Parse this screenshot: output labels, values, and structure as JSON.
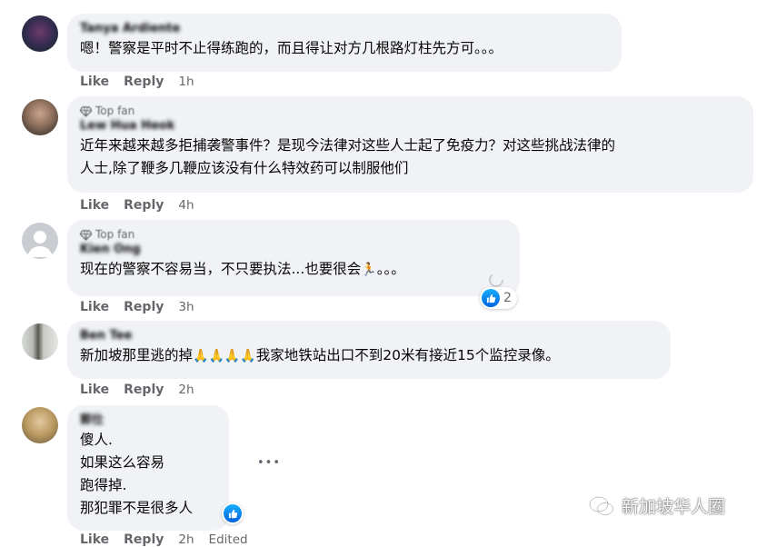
{
  "comments": [
    {
      "name": "Tanya Ardiente",
      "badge": "",
      "text": "嗯！警察是平时不止得练跑的，而且得让对方几根路灯柱先方可。。。",
      "like": "Like",
      "reply": "Reply",
      "time": "1h"
    },
    {
      "name": "Lew Hua Heok",
      "badge": "Top fan",
      "text": "近年来越来越多拒捕袭警事件？是现今法律对这些人士起了免疫力？对这些挑战法律的\n人士,除了鞭多几鞭应该没有什么特效药可以制服他们",
      "like": "Like",
      "reply": "Reply",
      "time": "4h"
    },
    {
      "name": "Kien Ong",
      "badge": "Top fan",
      "text_before": "现在的警察不容易当，不只要执法...也要很会",
      "emoji": "🏃",
      "text_after": "。。。",
      "reaction_count": "2",
      "like": "Like",
      "reply": "Reply",
      "time": "3h"
    },
    {
      "name": "Ben Tee",
      "badge": "",
      "text_before": "新加坡那里逃的掉",
      "emoji": "🙏🙏🙏🙏",
      "text_after": "我家地铁站出口不到20米有接近15个监控录像。",
      "like": "Like",
      "reply": "Reply",
      "time": "2h"
    },
    {
      "name": "郭仕",
      "badge": "",
      "lines": [
        "傻人.",
        "如果这么容易",
        "跑得掉.",
        "那犯罪不是很多人"
      ],
      "like": "Like",
      "reply": "Reply",
      "time": "2h",
      "edited": "Edited",
      "more": "•••"
    }
  ],
  "watermark": "新加坡华人圈",
  "icons": {
    "top_fan": "diamond-badge-icon",
    "like_reaction": "thumbs-up-icon",
    "more": "more-options-icon",
    "watermark": "wechat-icon"
  },
  "colors": {
    "bubble": "#f0f2f5",
    "secondary_text": "#65676b",
    "like_blue": "#0866ff"
  }
}
